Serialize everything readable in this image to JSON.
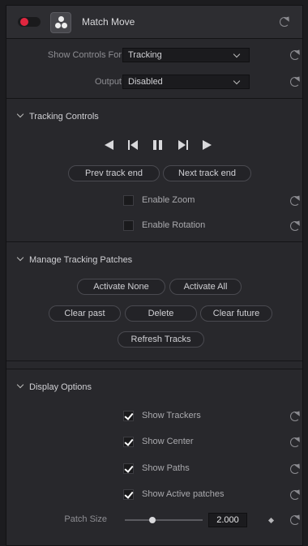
{
  "header": {
    "title": "Match Move"
  },
  "controls": {
    "show_controls_label": "Show Controls For",
    "show_controls_value": "Tracking",
    "output_label": "Output",
    "output_value": "Disabled"
  },
  "tracking": {
    "title": "Tracking Controls",
    "prev_label": "Prev track end",
    "next_label": "Next track end",
    "enable_zoom": {
      "label": "Enable Zoom",
      "checked": false
    },
    "enable_rotation": {
      "label": "Enable Rotation",
      "checked": false
    }
  },
  "patches": {
    "title": "Manage Tracking Patches",
    "activate_none": "Activate None",
    "activate_all": "Activate All",
    "clear_past": "Clear past",
    "delete": "Delete",
    "clear_future": "Clear future",
    "refresh": "Refresh Tracks"
  },
  "display": {
    "title": "Display Options",
    "show_trackers": {
      "label": "Show Trackers",
      "checked": true
    },
    "show_center": {
      "label": "Show Center",
      "checked": true
    },
    "show_paths": {
      "label": "Show Paths",
      "checked": true
    },
    "show_active": {
      "label": "Show Active patches",
      "checked": true
    },
    "patch_size_label": "Patch Size",
    "patch_size_value": "2.000",
    "patch_size_fraction": 0.35
  },
  "icons": [
    "toggle",
    "effect-icon",
    "reset-icon",
    "chevron-down-icon",
    "play-reverse-icon",
    "step-back-icon",
    "pause-icon",
    "step-forward-icon",
    "play-icon",
    "keyframe-icon"
  ]
}
